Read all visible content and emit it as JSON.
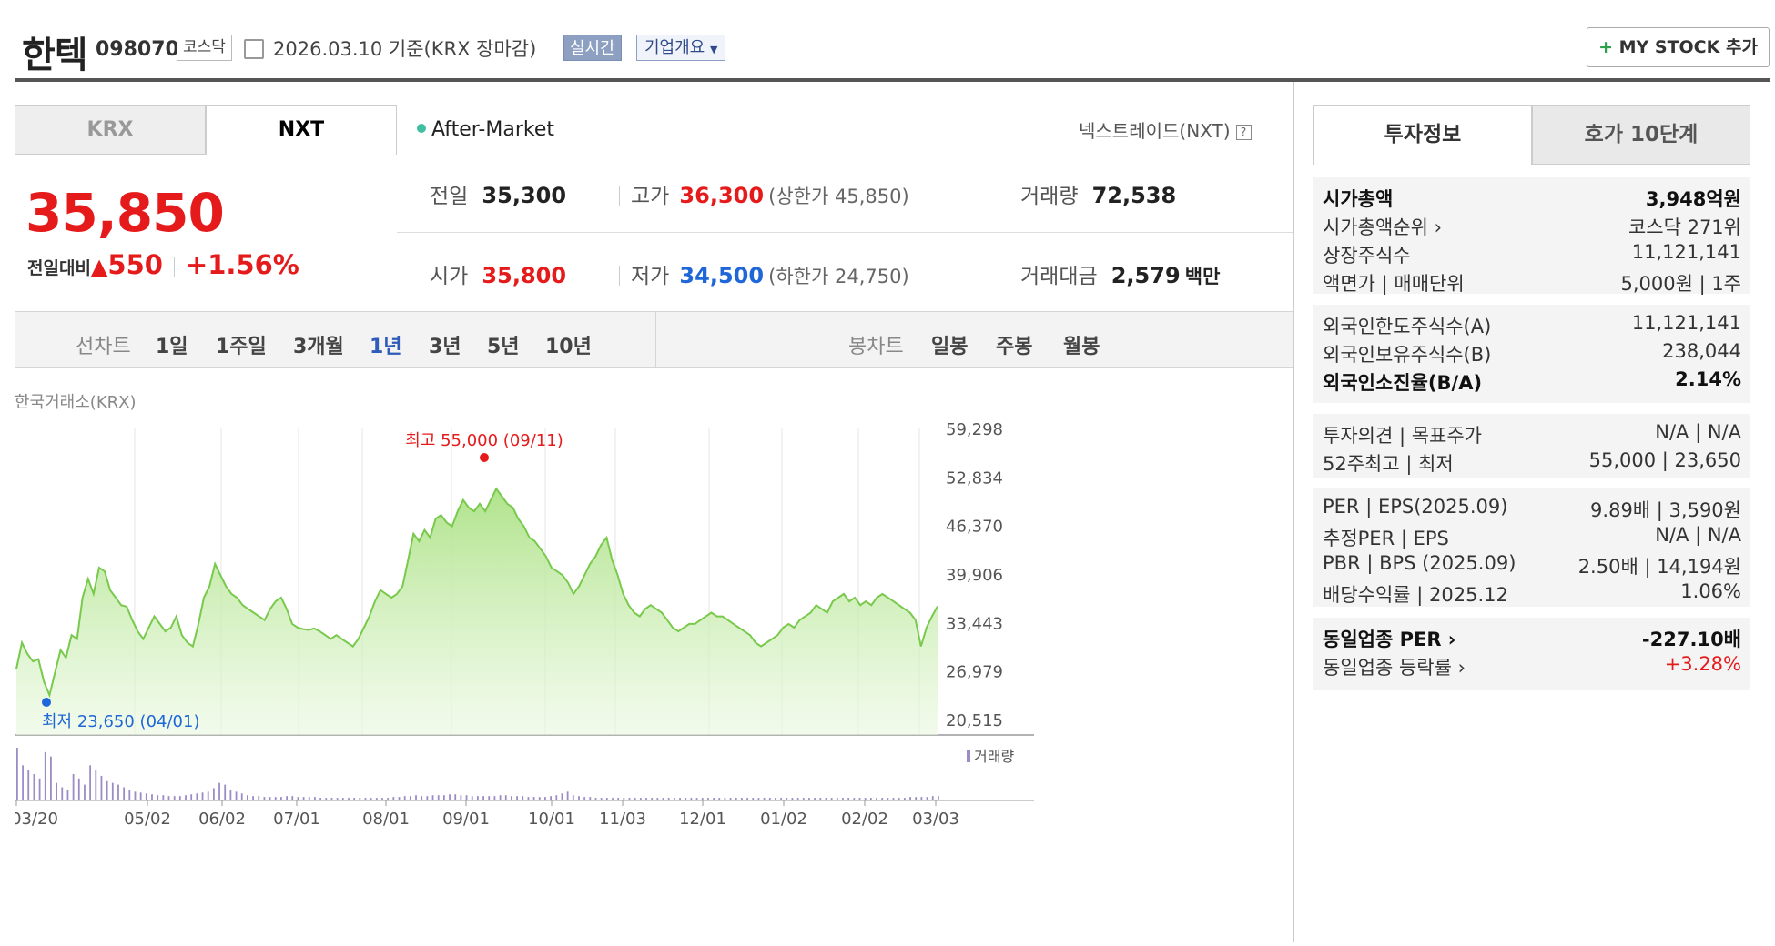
{
  "header": {
    "name": "한텍",
    "code": "098070",
    "market": "코스닥",
    "date": "2026.03.10 기준(KRX 장마감)",
    "realtime": "실시간",
    "company": "기업개요",
    "mystock": "MY STOCK 추가"
  },
  "tabs": [
    "KRX",
    "NXT"
  ],
  "after_market": "After-Market",
  "nxt_label": "넥스트레이드(NXT)",
  "price": "35,850",
  "change": {
    "label": "전일대비",
    "arrow": "▲",
    "amount": "550",
    "rate": "+1.56%"
  },
  "quote": {
    "prev_label": "전일",
    "prev": "35,300",
    "high_label": "고가",
    "high": "36,300",
    "upper": "(상한가 45,850)",
    "vol_label": "거래량",
    "vol": "72,538",
    "open_label": "시가",
    "open": "35,800",
    "low_label": "저가",
    "low": "34,500",
    "lower": "(하한가 24,750)",
    "amt_label": "거래대금",
    "amt": "2,579",
    "amt_unit": "백만"
  },
  "periods": {
    "line_label": "선차트",
    "items": [
      "1일",
      "1주일",
      "3개월",
      "1년",
      "3년",
      "5년",
      "10년"
    ],
    "active": "1년",
    "candle_label": "봉차트",
    "candle_items": [
      "일봉",
      "주봉",
      "월봉"
    ]
  },
  "exchange_label": "한국거래소(KRX)",
  "chart_data": {
    "type": "area",
    "y_ticks": [
      "59,298",
      "52,834",
      "46,370",
      "39,906",
      "33,443",
      "26,979",
      "20,515"
    ],
    "ylim": [
      20515,
      59298
    ],
    "x_ticks": [
      "03/20",
      "05/02",
      "06/02",
      "07/01",
      "08/01",
      "09/01",
      "10/01",
      "11/03",
      "12/01",
      "01/02",
      "02/02",
      "03/03"
    ],
    "high_label": "최고 55,000 (09/11)",
    "low_label": "최저 23,650 (04/01)",
    "volume_label": "거래량",
    "values": [
      27500,
      31000,
      29500,
      28500,
      28800,
      25800,
      24000,
      27000,
      30000,
      29000,
      32000,
      31500,
      37000,
      39500,
      37500,
      41000,
      40500,
      38000,
      37000,
      36000,
      35800,
      34000,
      32500,
      31500,
      33000,
      34500,
      33500,
      32500,
      33000,
      34500,
      32000,
      31000,
      30500,
      33500,
      37000,
      38500,
      41500,
      40000,
      38500,
      37500,
      37000,
      36000,
      35500,
      35000,
      34500,
      34000,
      35500,
      36500,
      37000,
      35500,
      33500,
      33000,
      32800,
      32700,
      32900,
      32500,
      32000,
      31500,
      32000,
      31500,
      31000,
      30500,
      31500,
      33000,
      34500,
      36500,
      38000,
      37500,
      37000,
      37500,
      38500,
      42000,
      45500,
      44500,
      46000,
      45000,
      47500,
      48000,
      47000,
      46500,
      48500,
      50000,
      49000,
      48500,
      49500,
      48500,
      50000,
      51500,
      50500,
      49500,
      49000,
      47500,
      46500,
      45000,
      44500,
      43500,
      42500,
      41000,
      40500,
      40000,
      39000,
      37500,
      38500,
      40000,
      41500,
      42500,
      44000,
      45000,
      42000,
      40000,
      37500,
      36000,
      35000,
      34500,
      35500,
      36000,
      35500,
      35000,
      34000,
      33000,
      32500,
      33000,
      33500,
      33500,
      34000,
      34500,
      35000,
      34500,
      34500,
      34000,
      33500,
      33000,
      32500,
      32000,
      31000,
      30500,
      31000,
      31500,
      32000,
      33000,
      33500,
      33000,
      34000,
      34500,
      35000,
      36000,
      35500,
      35000,
      36500,
      37000,
      37500,
      36500,
      37000,
      36000,
      36500,
      36000,
      37000,
      37500,
      37000,
      36500,
      36000,
      35500,
      35000,
      34000,
      30500,
      33000,
      34500,
      35850
    ],
    "volumes": [
      60,
      40,
      35,
      30,
      25,
      55,
      50,
      20,
      15,
      12,
      30,
      25,
      18,
      40,
      35,
      28,
      22,
      20,
      18,
      15,
      12,
      10,
      9,
      8,
      7,
      6,
      6,
      5,
      5,
      5,
      6,
      7,
      8,
      9,
      10,
      14,
      20,
      18,
      12,
      10,
      8,
      6,
      5,
      5,
      4,
      4,
      4,
      4,
      5,
      5,
      4,
      4,
      4,
      4,
      3,
      3,
      3,
      3,
      3,
      3,
      3,
      3,
      3,
      3,
      3,
      3,
      3,
      4,
      4,
      5,
      5,
      6,
      5,
      5,
      6,
      6,
      6,
      7,
      7,
      6,
      6,
      5,
      5,
      5,
      5,
      5,
      6,
      6,
      5,
      5,
      5,
      4,
      4,
      4,
      4,
      5,
      6,
      8,
      10,
      6,
      5,
      4,
      4,
      3,
      3,
      3,
      3,
      3,
      3,
      3,
      3,
      3,
      3,
      3,
      3,
      3,
      3,
      3,
      3,
      3,
      3,
      3,
      3,
      3,
      3,
      3,
      3,
      3,
      3,
      3,
      3,
      3,
      3,
      3,
      3,
      3,
      3,
      3,
      3,
      3,
      3,
      3,
      3,
      3,
      3,
      3,
      3,
      3,
      3,
      3,
      3,
      3,
      3,
      3,
      3,
      3,
      3,
      3,
      3,
      4,
      4,
      4,
      4,
      5,
      5
    ]
  },
  "side": {
    "tabs": [
      "투자정보",
      "호가 10단계"
    ],
    "rows1": [
      {
        "l": "시가총액",
        "r": "3,948억원",
        "bold": true
      },
      {
        "l": "시가총액순위 ›",
        "r": "코스닥 271위"
      },
      {
        "l": "상장주식수",
        "r": "11,121,141"
      },
      {
        "l": "액면가 | 매매단위",
        "r": "5,000원 | 1주"
      }
    ],
    "rows2": [
      {
        "l": "외국인한도주식수(A)",
        "r": "11,121,141"
      },
      {
        "l": "외국인보유주식수(B)",
        "r": "238,044"
      },
      {
        "l": "외국인소진율(B/A)",
        "r": "2.14%",
        "bold": true
      }
    ],
    "rows3": [
      {
        "l": "투자의견 | 목표주가",
        "r": "N/A | N/A"
      },
      {
        "l": "52주최고 | 최저",
        "r": "55,000 | 23,650"
      }
    ],
    "rows4": [
      {
        "l": "PER | EPS(2025.09)",
        "r": "9.89배 | 3,590원"
      },
      {
        "l": "추정PER | EPS",
        "r": "N/A | N/A"
      },
      {
        "l": "PBR | BPS (2025.09)",
        "r": "2.50배 | 14,194원"
      },
      {
        "l": "배당수익률 | 2025.12",
        "r": "1.06%"
      }
    ],
    "rows5": [
      {
        "l": "동일업종 PER ›",
        "r": "-227.10배",
        "bold": true
      },
      {
        "l": "동일업종 등락률 ›",
        "r": "+3.28%",
        "red": true
      }
    ]
  },
  "colors": {
    "up": "#e51a1a",
    "down": "#1f66d8",
    "area": "#8fd36b"
  }
}
